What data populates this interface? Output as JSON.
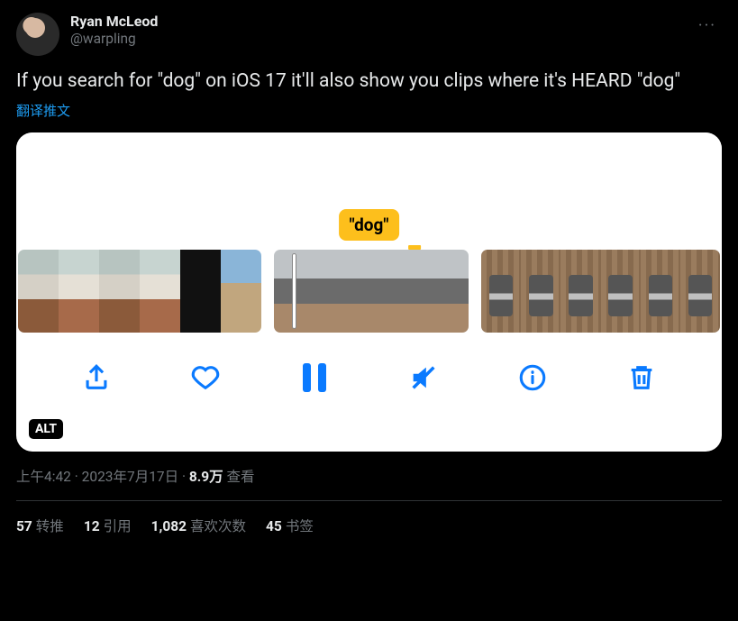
{
  "author": {
    "display_name": "Ryan McLeod",
    "handle": "@warpling"
  },
  "tweet_text": "If you search for \"dog\" on iOS 17 it'll also show you clips where it's HEARD \"dog\"",
  "translate_label": "翻译推文",
  "media": {
    "caption_tag": "\"dog\"",
    "alt_badge": "ALT",
    "toolbar": {
      "share": "share-icon",
      "like": "heart-icon",
      "pause": "pause-icon",
      "mute": "speaker-mute-icon",
      "info": "info-icon",
      "delete": "trash-icon"
    }
  },
  "meta": {
    "time": "上午4:42",
    "date": "2023年7月17日",
    "views_count": "8.9万",
    "views_label": "查看"
  },
  "stats": {
    "retweets": {
      "count": "57",
      "label": "转推"
    },
    "quotes": {
      "count": "12",
      "label": "引用"
    },
    "likes": {
      "count": "1,082",
      "label": "喜欢次数"
    },
    "bookmarks": {
      "count": "45",
      "label": "书签"
    }
  }
}
